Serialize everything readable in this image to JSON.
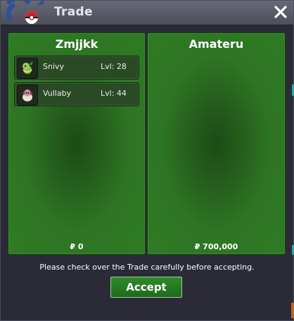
{
  "window": {
    "title": "Trade",
    "close_icon": "close-icon"
  },
  "offers": [
    {
      "trainer": "Zmjjkk",
      "pokemon": [
        {
          "name": "Snivy",
          "level": "Lvl: 28",
          "icon": "snivy-icon"
        },
        {
          "name": "Vullaby",
          "level": "Lvl: 44",
          "icon": "vullaby-icon"
        }
      ],
      "money": "₽ 0"
    },
    {
      "trainer": "Amateru",
      "pokemon": [],
      "money": "₽ 700,000"
    }
  ],
  "notice": "Please check over the Trade carefully before accepting.",
  "accept_label": "Accept",
  "colors": {
    "panel_green": "#2f7c25",
    "titlebar": "#5a5b68",
    "window_bg": "#2a2b36"
  }
}
